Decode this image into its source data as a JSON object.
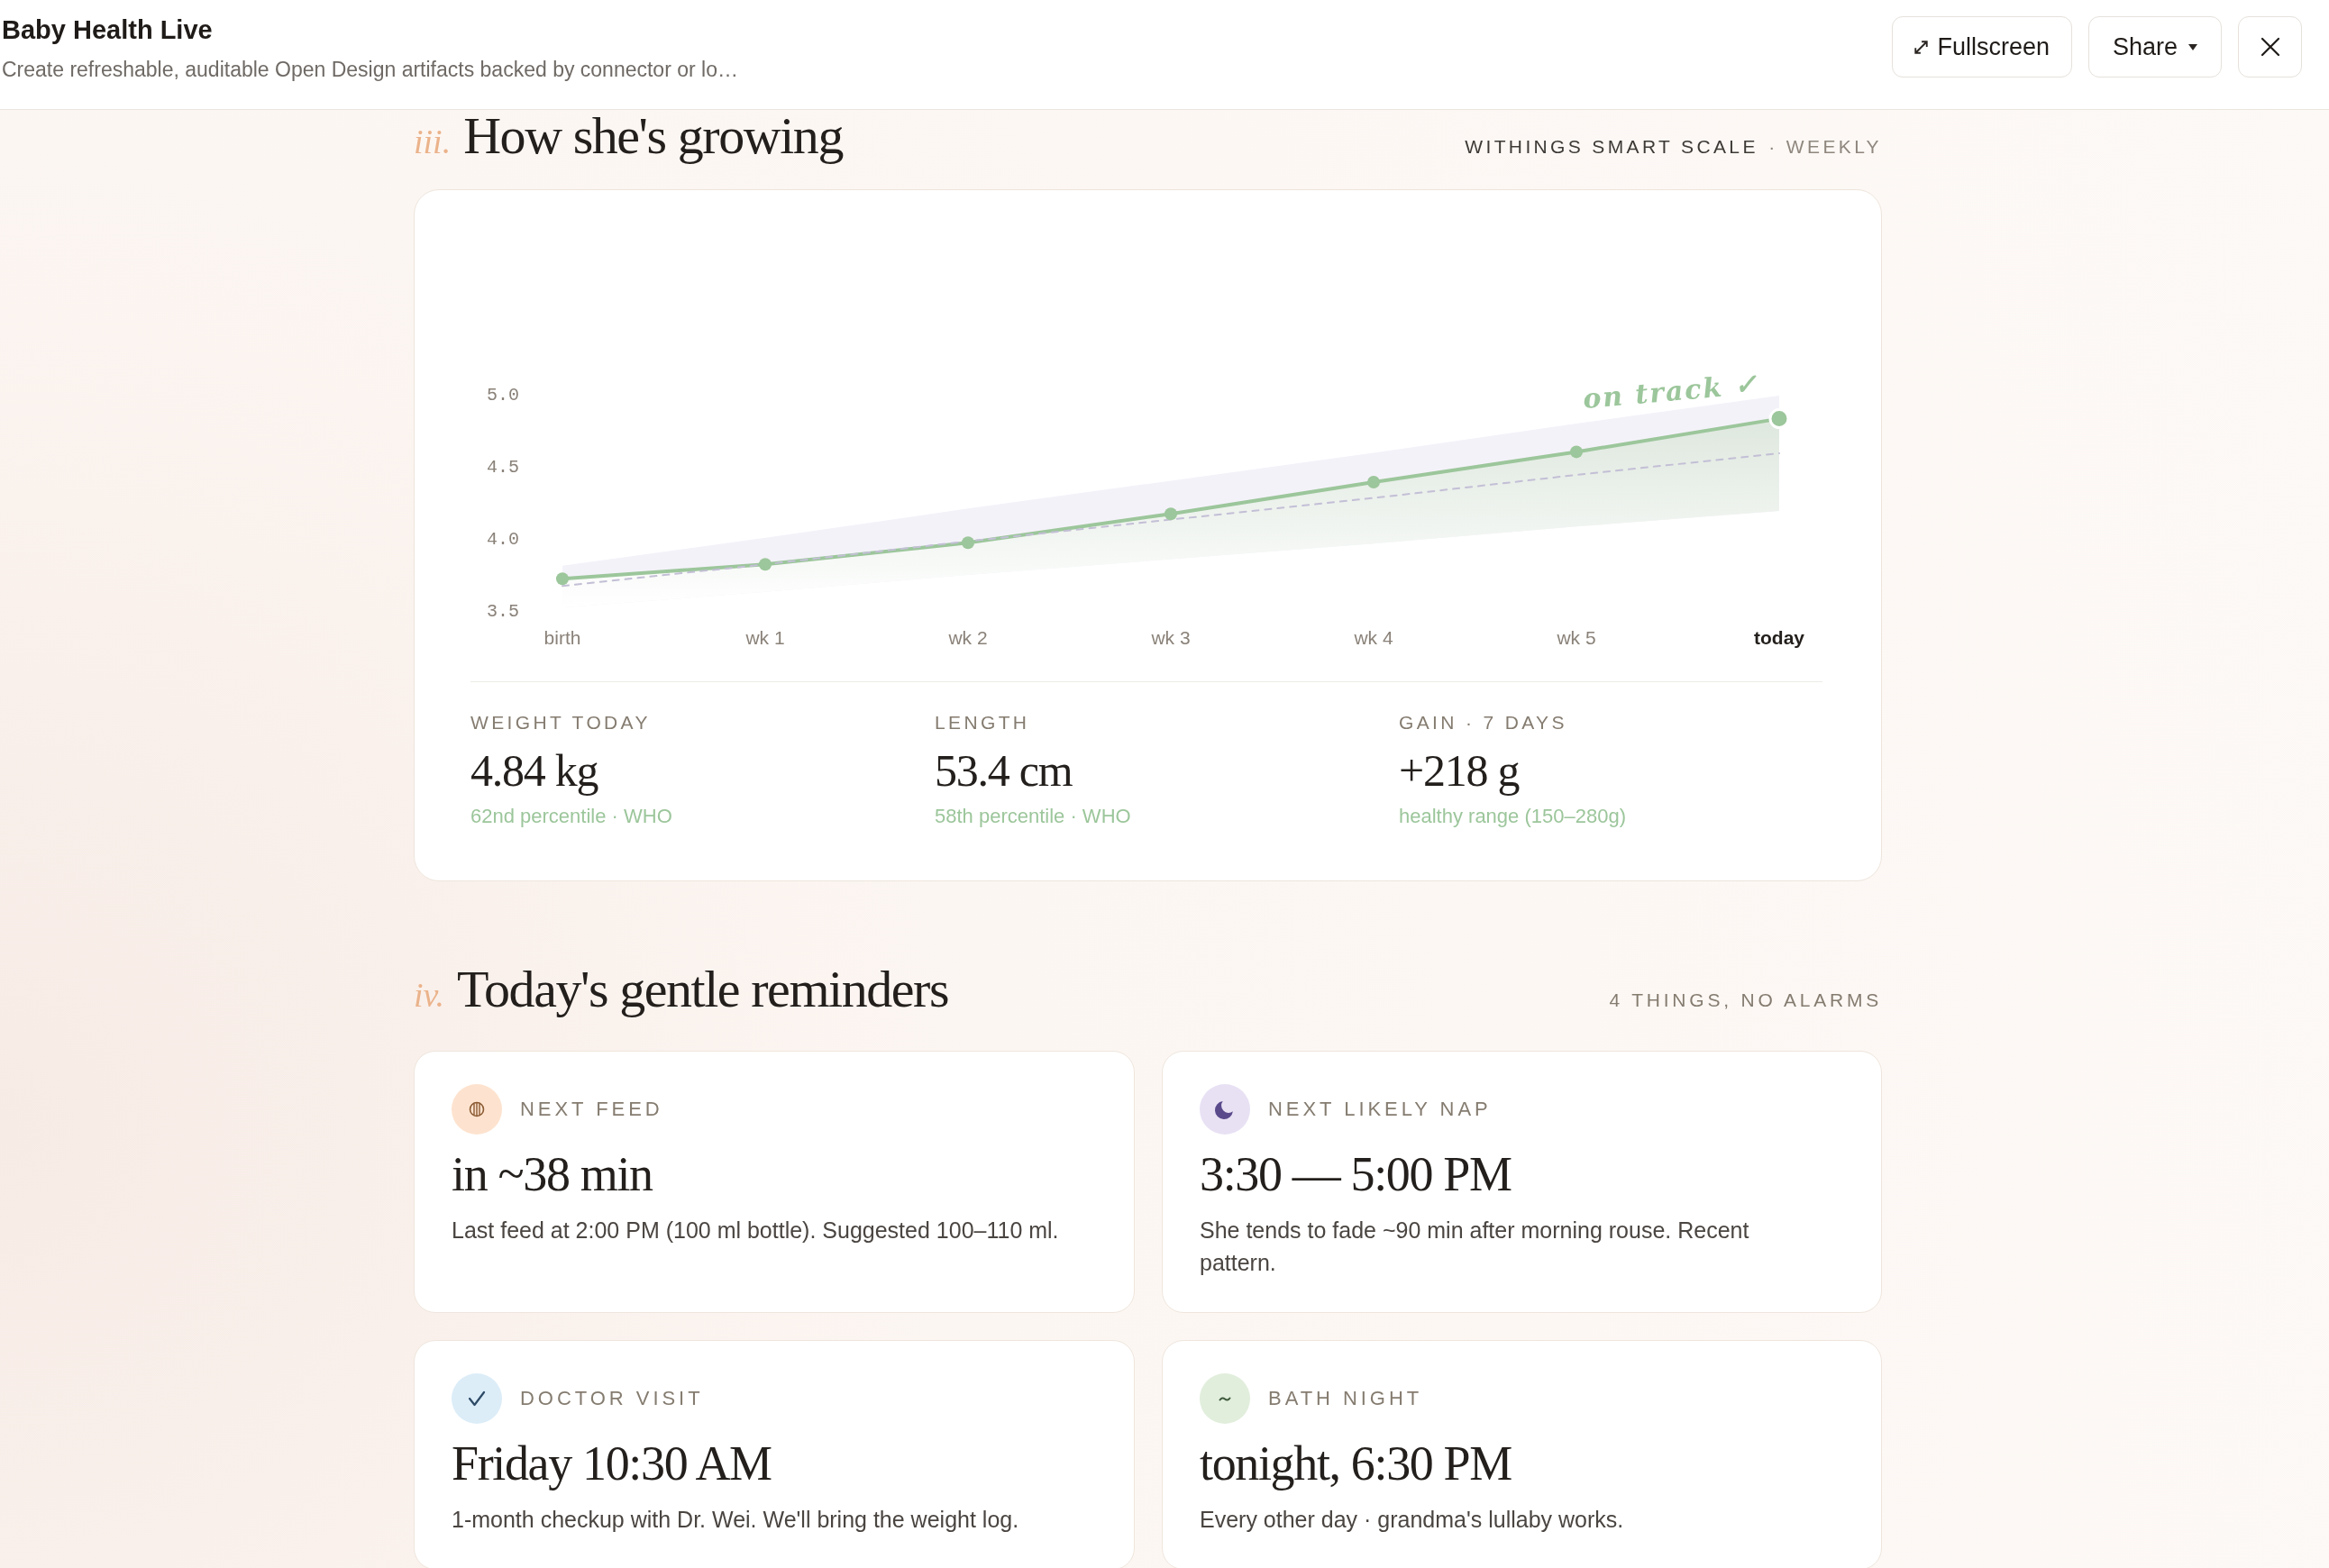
{
  "header": {
    "title": "Baby Health Live",
    "subtitle": "Create refreshable, auditable Open Design artifacts backed by connector or lo…",
    "buttons": [
      {
        "kind": "fullscreen",
        "label": "Fullscreen"
      },
      {
        "kind": "share",
        "label": "Share"
      },
      {
        "kind": "close"
      }
    ]
  },
  "growth": {
    "numeral": "iii.",
    "title": "How she's growing",
    "source": "WITHINGS SMART SCALE",
    "cadence": "· WEEKLY",
    "chart_data": {
      "type": "line",
      "categories": [
        "birth",
        "wk 1",
        "wk 2",
        "wk 3",
        "wk 4",
        "wk 5",
        "today"
      ],
      "ylim": [
        3.5,
        5.0
      ],
      "yticks": [
        {
          "value": 5.0,
          "label": "5.0"
        },
        {
          "value": 4.5,
          "label": "4.5"
        },
        {
          "value": 4.0,
          "label": "4.0"
        },
        {
          "value": 3.5,
          "label": "3.5"
        }
      ],
      "series": [
        {
          "color": "#9cc69b",
          "line_style": "solid",
          "marker": "circle",
          "values": [
            3.73,
            3.83,
            3.98,
            4.18,
            4.4,
            4.61,
            4.84
          ]
        },
        {
          "color": "#c3bfd6",
          "line_style": "dashed",
          "values": [
            3.68,
            3.83,
            3.99,
            4.14,
            4.29,
            4.45,
            4.6
          ]
        }
      ],
      "annotations": [
        "on track ✓"
      ]
    },
    "stats": [
      {
        "label": "WEIGHT TODAY",
        "value": "4.84 kg",
        "note": "62nd percentile · WHO"
      },
      {
        "label": "LENGTH",
        "value": "53.4 cm",
        "note": "58th percentile · WHO"
      },
      {
        "label": "GAIN · 7 DAYS",
        "value": "+218 g",
        "note": "healthy range (150–280g)"
      }
    ]
  },
  "reminders": {
    "numeral": "iv.",
    "title": "Today's gentle reminders",
    "summary": "4 THINGS, NO ALARMS",
    "items": [
      {
        "kind": "feed",
        "label": "NEXT FEED",
        "value": "in ~38 min",
        "detail": "Last feed at 2:00 PM (100 ml bottle). Suggested 100–110 ml."
      },
      {
        "kind": "nap",
        "label": "NEXT LIKELY NAP",
        "value": "3:30 — 5:00 PM",
        "detail": "She tends to fade ~90 min after morning rouse. Recent pattern."
      },
      {
        "kind": "doctor",
        "label": "DOCTOR VISIT",
        "value": "Friday 10:30 AM",
        "detail": "1-month checkup with Dr. Wei. We'll bring the weight log."
      },
      {
        "kind": "bath",
        "label": "BATH NIGHT",
        "value": "tonight, 6:30 PM",
        "detail": "Every other day · grandma's lullaby works."
      }
    ]
  }
}
